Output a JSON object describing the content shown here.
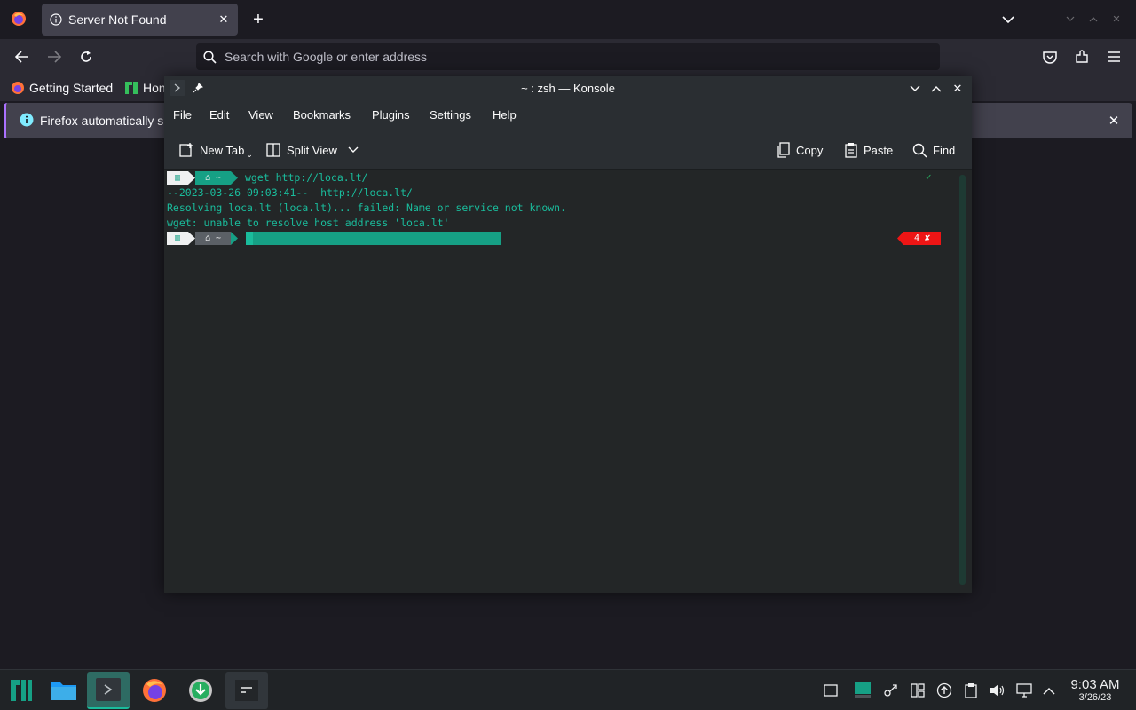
{
  "firefox": {
    "tab_title": "Server Not Found",
    "url_placeholder": "Search with Google or enter address",
    "bookmarks": [
      "Getting Started",
      "Hon"
    ],
    "info_text": "Firefox automatically s"
  },
  "konsole": {
    "title": "~ : zsh — Konsole",
    "menu": [
      "File",
      "Edit",
      "View",
      "Bookmarks",
      "Plugins",
      "Settings",
      "Help"
    ],
    "toolbar": {
      "new_tab": "New Tab",
      "split_view": "Split View",
      "copy": "Copy",
      "paste": "Paste",
      "find": "Find"
    },
    "terminal": {
      "prompt_home": "~",
      "command": "wget http://loca.lt/",
      "output": [
        "--2023-03-26 09:03:41--  http://loca.lt/",
        "Resolving loca.lt (loca.lt)... failed: Name or service not known.",
        "wget: unable to resolve host address 'loca.lt'"
      ],
      "status_ok": "✓",
      "error_code": "4 ✘"
    }
  },
  "taskbar": {
    "clock_time": "9:03 AM",
    "clock_date": "3/26/23"
  },
  "colors": {
    "accent_teal": "#16a085",
    "terminal_text": "#1abc9c",
    "error_red": "#ed1515"
  }
}
